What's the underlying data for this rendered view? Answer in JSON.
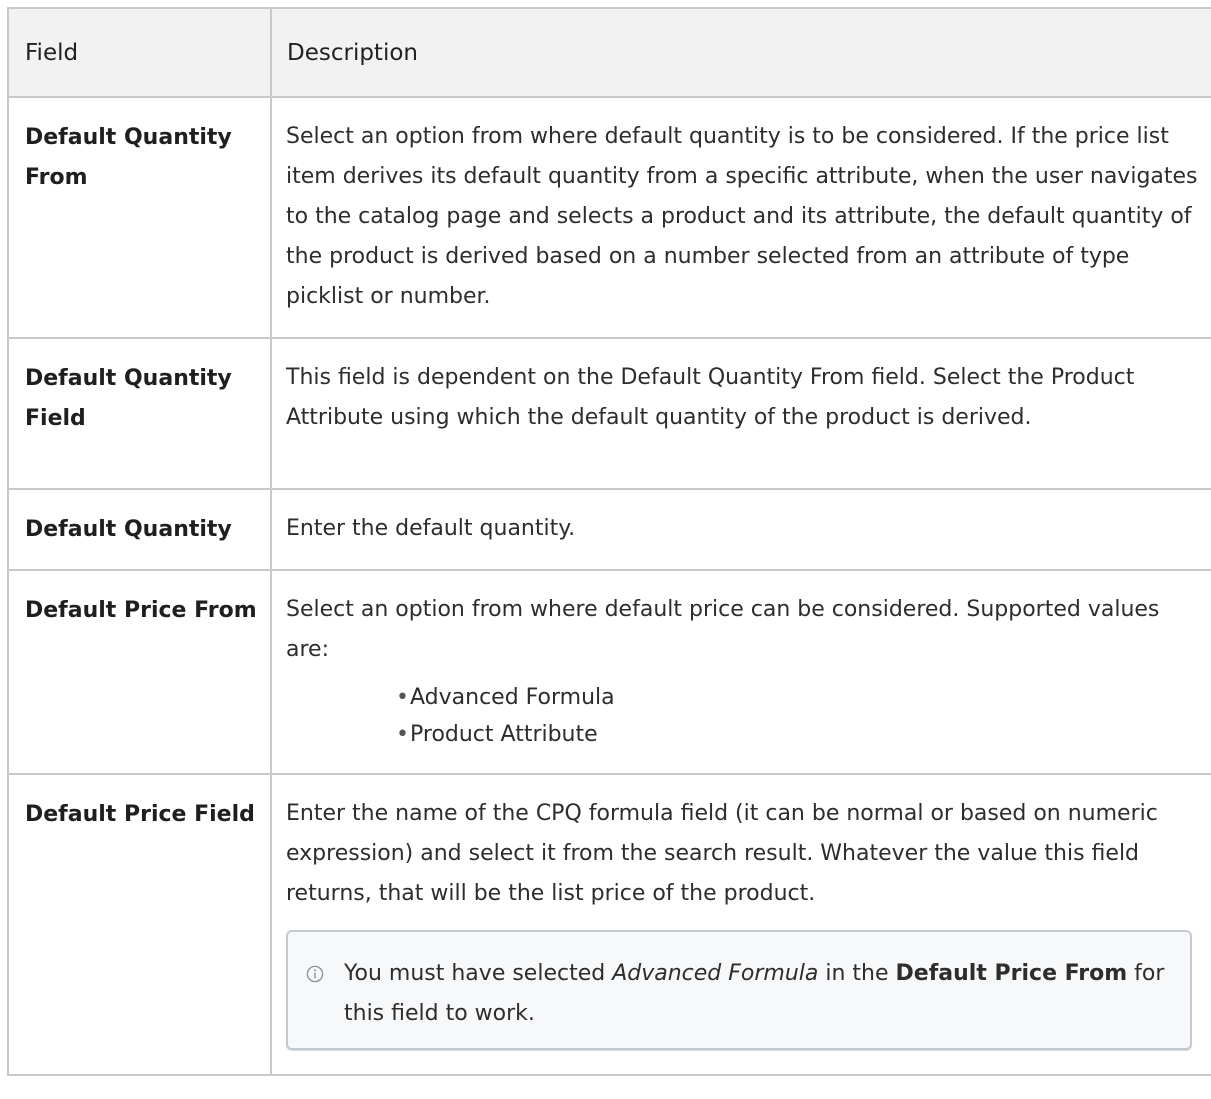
{
  "table": {
    "headers": {
      "field": "Field",
      "description": "Description"
    },
    "rows": [
      {
        "field": "Default Quantity From",
        "description": "Select an option from where default quantity is to be considered. If the price list item derives its default quantity from a specific attribute, when the user navigates to the catalog page and selects a product and its attribute, the default quantity of the product is derived based on a number selected from an attribute of type picklist or number."
      },
      {
        "field": "Default Quantity Field",
        "description": "This field is dependent on the Default Quantity From field. Select the Product Attribute using which the default quantity of the product is derived."
      },
      {
        "field": "Default Quantity",
        "description": "Enter the default quantity."
      },
      {
        "field": "Default Price From",
        "description": "Select an option from where default price can be considered. Supported values are:",
        "bullets": [
          "Advanced Formula",
          "Product Attribute"
        ]
      },
      {
        "field": "Default Price Field",
        "description": "Enter the name of the CPQ formula field (it can be normal or based on numeric expression) and select it from the search result. Whatever the value this field returns, that will be the list price of the product.",
        "note": {
          "icon": "info-icon",
          "part1": "You must have selected ",
          "italic": "Advanced Formula",
          "part2": " in the ",
          "bold": "Default Price From",
          "part3": " for this field to work."
        }
      }
    ]
  }
}
